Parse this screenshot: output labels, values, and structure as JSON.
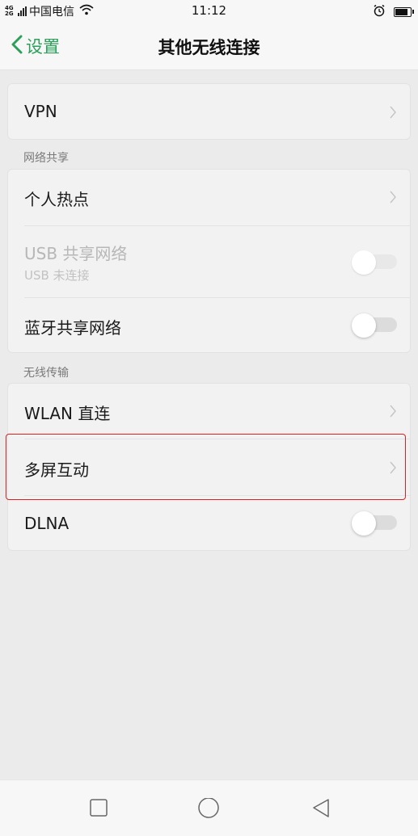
{
  "status_bar": {
    "network": "4G 2G",
    "carrier": "中国电信",
    "time": "11:12",
    "icons": [
      "signal-icon",
      "wifi-icon",
      "alarm-icon",
      "battery-icon"
    ]
  },
  "header": {
    "back_label": "设置",
    "title": "其他无线连接"
  },
  "groups": [
    {
      "title": "",
      "items": [
        {
          "label": "VPN",
          "control": "chevron"
        }
      ]
    },
    {
      "title": "网络共享",
      "items": [
        {
          "label": "个人热点",
          "control": "chevron"
        },
        {
          "label": "USB 共享网络",
          "sublabel": "USB 未连接",
          "control": "toggle",
          "state": "off",
          "disabled": true
        },
        {
          "label": "蓝牙共享网络",
          "control": "toggle",
          "state": "off"
        }
      ]
    },
    {
      "title": "无线传输",
      "items": [
        {
          "label": "WLAN 直连",
          "control": "chevron"
        },
        {
          "label": "多屏互动",
          "control": "chevron",
          "highlighted": true
        },
        {
          "label": "DLNA",
          "control": "toggle",
          "state": "off"
        }
      ]
    }
  ],
  "bottom_nav": [
    "recent-apps-icon",
    "home-icon",
    "back-icon"
  ],
  "colors": {
    "accent": "#2aa05a",
    "background": "#ebebeb",
    "card": "#f2f2f2",
    "highlight": "#e02020"
  }
}
